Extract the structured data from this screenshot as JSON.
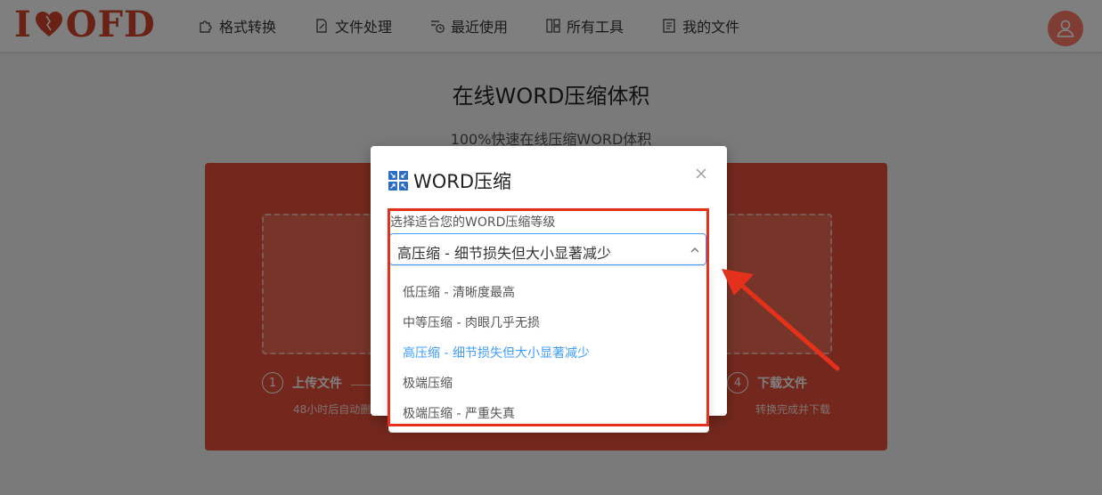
{
  "header": {
    "logo": {
      "left": "I",
      "right": "OFD"
    },
    "nav": [
      {
        "label": "格式转换",
        "icon": "puzzle-icon"
      },
      {
        "label": "文件处理",
        "icon": "file-edit-icon"
      },
      {
        "label": "最近使用",
        "icon": "clock-list-icon"
      },
      {
        "label": "所有工具",
        "icon": "grid-icon"
      },
      {
        "label": "我的文件",
        "icon": "document-icon"
      }
    ],
    "avatar_icon": "user-icon"
  },
  "main": {
    "title": "在线WORD压缩体积",
    "subtitle": "100%快速在线压缩WORD体积",
    "steps": [
      {
        "num": "1",
        "title": "上传文件",
        "desc": "48小时后自动删"
      },
      {
        "num": "4",
        "title": "下载文件",
        "desc": "转换完成并下载"
      }
    ]
  },
  "modal": {
    "title": "WORD压缩",
    "title_icon": "compress-icon",
    "close_icon": "close-icon",
    "field_label": "选择适合您的WORD压缩等级",
    "selected_value": "高压缩 - 细节损失但大小显著减少",
    "options": [
      "低压缩 - 清晰度最高",
      "中等压缩 - 肉眼几乎无损",
      "高压缩 - 细节损失但大小显著减少",
      "极端压缩",
      "极端压缩 - 严重失真"
    ],
    "selected_index": 2
  },
  "colors": {
    "brand": "#d2452b",
    "highlight": "#e3311c",
    "selected_option": "#409eff"
  }
}
